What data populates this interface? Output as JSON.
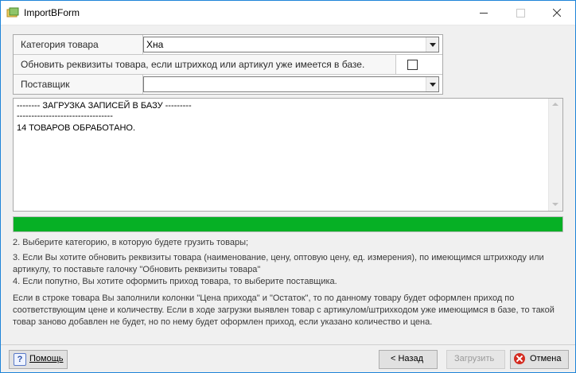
{
  "window": {
    "title": "ImportBForm"
  },
  "form": {
    "category_label": "Категория товара",
    "category_value": "Хна",
    "update_label": "Обновить реквизиты товара, если штрихкод или артикул уже имеется в базе.",
    "update_checked": false,
    "supplier_label": "Поставщик",
    "supplier_value": ""
  },
  "log": {
    "lines": [
      "-------- ЗАГРУЗКА ЗАПИСЕЙ В БАЗУ ---------",
      "---------------------------------",
      "14 ТОВАРОВ ОБРАБОТАНО."
    ]
  },
  "progress": {
    "percent": 100,
    "color": "#06b025"
  },
  "instructions": {
    "step2": "2. Выберите категорию, в которую будете грузить товары;",
    "step3": "3. Если Вы хотите обновить реквизиты товара (наименование, цену, оптовую цену, ед. измерения), по имеющимся штрихкоду или артикулу, то поставьте галочку \"Обновить реквизиты товара\"",
    "step4": "4. Если попутно, Вы хотите оформить приход товара, то выберите поставщика.",
    "note": "Если в строке товара Вы заполнили колонки \"Цена прихода\" и \"Остаток\", то по данному товару будет оформлен приход по соответствующим цене и количеству. Если в ходе загрузки выявлен товар с артикулом/штрихкодом уже имеющимся в базе, то такой товар заново добавлен не будет, но по нему будет оформлен приход, если указано количество и цена."
  },
  "buttons": {
    "help": "Помощь",
    "back": "< Назад",
    "load": "Загрузить",
    "cancel": "Отмена"
  }
}
